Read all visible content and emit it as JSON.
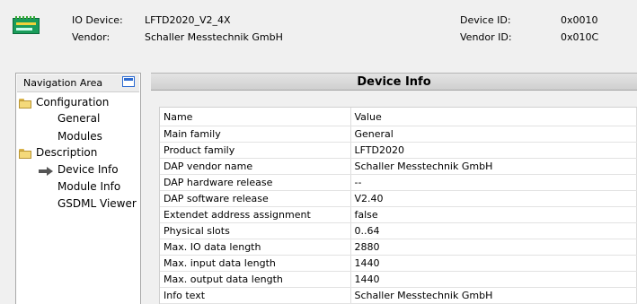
{
  "header": {
    "io_device_label": "IO Device:",
    "io_device_value": "LFTD2020_V2_4X",
    "vendor_label": "Vendor:",
    "vendor_value": "Schaller Messtechnik GmbH",
    "device_id_label": "Device ID:",
    "device_id_value": "0x0010",
    "vendor_id_label": "Vendor ID:",
    "vendor_id_value": "0x010C",
    "icon": "device-module-icon"
  },
  "nav": {
    "title": "Navigation Area",
    "button_icon": "window-restore-icon",
    "tree": {
      "configuration": "Configuration",
      "general": "General",
      "modules": "Modules",
      "description": "Description",
      "device_info": "Device Info",
      "module_info": "Module Info",
      "gsdml_viewer": "GSDML Viewer"
    }
  },
  "main": {
    "title": "Device Info",
    "columns": {
      "name": "Name",
      "value": "Value"
    },
    "rows": [
      {
        "name": "Main family",
        "value": "General"
      },
      {
        "name": "Product family",
        "value": "LFTD2020"
      },
      {
        "name": "DAP vendor name",
        "value": "Schaller Messtechnik GmbH"
      },
      {
        "name": "DAP hardware release",
        "value": "--"
      },
      {
        "name": "DAP software release",
        "value": "V2.40"
      },
      {
        "name": "Extendet address assignment",
        "value": "false"
      },
      {
        "name": "Physical slots",
        "value": "0..64"
      },
      {
        "name": "Max. IO data length",
        "value": "2880"
      },
      {
        "name": "Max. input data length",
        "value": "1440"
      },
      {
        "name": "Max. output data length",
        "value": "1440"
      },
      {
        "name": "Info text",
        "value": "Schaller Messtechnik GmbH"
      }
    ]
  }
}
